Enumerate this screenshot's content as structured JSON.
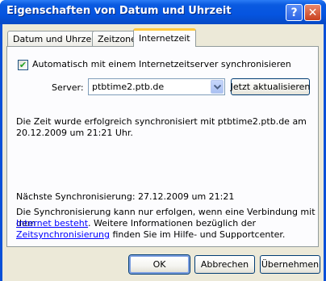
{
  "window": {
    "title": "Eigenschaften von Datum und Uhrzeit",
    "help_glyph": "?",
    "close_glyph": "✕"
  },
  "tabs": [
    {
      "label": "Datum und Uhrzeit",
      "active": false
    },
    {
      "label": "Zeitzone",
      "active": false
    },
    {
      "label": "Internetzeit",
      "active": true
    }
  ],
  "internet_time": {
    "sync_checkbox_checked": true,
    "sync_label": "Automatisch mit einem Internetzeitserver synchronisieren",
    "server_label": "Server:",
    "server_value": "ptbtime2.ptb.de",
    "update_button": "Jetzt aktualisieren",
    "status_line1": "Die Zeit wurde erfolgreich synchronisiert mit ptbtime2.ptb.de am",
    "status_line2": "20.12.2009 um 21:21 Uhr.",
    "next_sync": "Nächste Synchronisierung: 27.12.2009 um 21:21",
    "info_line1": "Die Synchronisierung kann nur erfolgen, wenn eine Verbindung mit dem",
    "info_line2_link": "Internet besteht",
    "info_line2_rest": ". Weitere Informationen bezüglich der",
    "info_line3_link": "Zeitsynchronisierung",
    "info_line3_rest": " finden Sie im Hilfe- und Supportcenter."
  },
  "buttons": {
    "ok": "OK",
    "cancel": "Abbrechen",
    "apply": "Übernehmen"
  },
  "colors": {
    "titlebar": "#0554e0",
    "dialog_bg": "#ece9d8",
    "active_tab_accent": "#ffc83c",
    "link": "#0000ff"
  }
}
